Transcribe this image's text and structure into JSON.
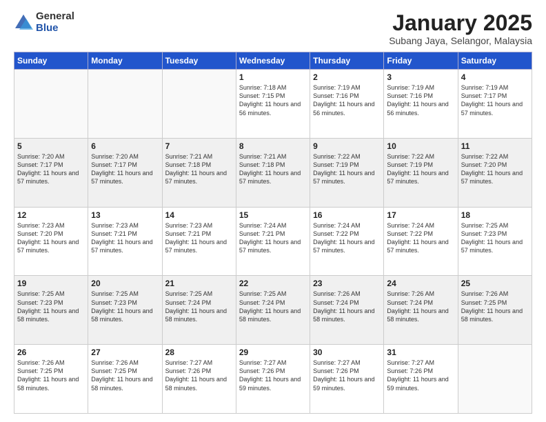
{
  "logo": {
    "general": "General",
    "blue": "Blue"
  },
  "header": {
    "month": "January 2025",
    "location": "Subang Jaya, Selangor, Malaysia"
  },
  "days_of_week": [
    "Sunday",
    "Monday",
    "Tuesday",
    "Wednesday",
    "Thursday",
    "Friday",
    "Saturday"
  ],
  "weeks": [
    [
      {
        "day": "",
        "info": ""
      },
      {
        "day": "",
        "info": ""
      },
      {
        "day": "",
        "info": ""
      },
      {
        "day": "1",
        "info": "Sunrise: 7:18 AM\nSunset: 7:15 PM\nDaylight: 11 hours and 56 minutes."
      },
      {
        "day": "2",
        "info": "Sunrise: 7:19 AM\nSunset: 7:16 PM\nDaylight: 11 hours and 56 minutes."
      },
      {
        "day": "3",
        "info": "Sunrise: 7:19 AM\nSunset: 7:16 PM\nDaylight: 11 hours and 56 minutes."
      },
      {
        "day": "4",
        "info": "Sunrise: 7:19 AM\nSunset: 7:17 PM\nDaylight: 11 hours and 57 minutes."
      }
    ],
    [
      {
        "day": "5",
        "info": "Sunrise: 7:20 AM\nSunset: 7:17 PM\nDaylight: 11 hours and 57 minutes."
      },
      {
        "day": "6",
        "info": "Sunrise: 7:20 AM\nSunset: 7:17 PM\nDaylight: 11 hours and 57 minutes."
      },
      {
        "day": "7",
        "info": "Sunrise: 7:21 AM\nSunset: 7:18 PM\nDaylight: 11 hours and 57 minutes."
      },
      {
        "day": "8",
        "info": "Sunrise: 7:21 AM\nSunset: 7:18 PM\nDaylight: 11 hours and 57 minutes."
      },
      {
        "day": "9",
        "info": "Sunrise: 7:22 AM\nSunset: 7:19 PM\nDaylight: 11 hours and 57 minutes."
      },
      {
        "day": "10",
        "info": "Sunrise: 7:22 AM\nSunset: 7:19 PM\nDaylight: 11 hours and 57 minutes."
      },
      {
        "day": "11",
        "info": "Sunrise: 7:22 AM\nSunset: 7:20 PM\nDaylight: 11 hours and 57 minutes."
      }
    ],
    [
      {
        "day": "12",
        "info": "Sunrise: 7:23 AM\nSunset: 7:20 PM\nDaylight: 11 hours and 57 minutes."
      },
      {
        "day": "13",
        "info": "Sunrise: 7:23 AM\nSunset: 7:21 PM\nDaylight: 11 hours and 57 minutes."
      },
      {
        "day": "14",
        "info": "Sunrise: 7:23 AM\nSunset: 7:21 PM\nDaylight: 11 hours and 57 minutes."
      },
      {
        "day": "15",
        "info": "Sunrise: 7:24 AM\nSunset: 7:21 PM\nDaylight: 11 hours and 57 minutes."
      },
      {
        "day": "16",
        "info": "Sunrise: 7:24 AM\nSunset: 7:22 PM\nDaylight: 11 hours and 57 minutes."
      },
      {
        "day": "17",
        "info": "Sunrise: 7:24 AM\nSunset: 7:22 PM\nDaylight: 11 hours and 57 minutes."
      },
      {
        "day": "18",
        "info": "Sunrise: 7:25 AM\nSunset: 7:23 PM\nDaylight: 11 hours and 57 minutes."
      }
    ],
    [
      {
        "day": "19",
        "info": "Sunrise: 7:25 AM\nSunset: 7:23 PM\nDaylight: 11 hours and 58 minutes."
      },
      {
        "day": "20",
        "info": "Sunrise: 7:25 AM\nSunset: 7:23 PM\nDaylight: 11 hours and 58 minutes."
      },
      {
        "day": "21",
        "info": "Sunrise: 7:25 AM\nSunset: 7:24 PM\nDaylight: 11 hours and 58 minutes."
      },
      {
        "day": "22",
        "info": "Sunrise: 7:25 AM\nSunset: 7:24 PM\nDaylight: 11 hours and 58 minutes."
      },
      {
        "day": "23",
        "info": "Sunrise: 7:26 AM\nSunset: 7:24 PM\nDaylight: 11 hours and 58 minutes."
      },
      {
        "day": "24",
        "info": "Sunrise: 7:26 AM\nSunset: 7:24 PM\nDaylight: 11 hours and 58 minutes."
      },
      {
        "day": "25",
        "info": "Sunrise: 7:26 AM\nSunset: 7:25 PM\nDaylight: 11 hours and 58 minutes."
      }
    ],
    [
      {
        "day": "26",
        "info": "Sunrise: 7:26 AM\nSunset: 7:25 PM\nDaylight: 11 hours and 58 minutes."
      },
      {
        "day": "27",
        "info": "Sunrise: 7:26 AM\nSunset: 7:25 PM\nDaylight: 11 hours and 58 minutes."
      },
      {
        "day": "28",
        "info": "Sunrise: 7:27 AM\nSunset: 7:26 PM\nDaylight: 11 hours and 58 minutes."
      },
      {
        "day": "29",
        "info": "Sunrise: 7:27 AM\nSunset: 7:26 PM\nDaylight: 11 hours and 59 minutes."
      },
      {
        "day": "30",
        "info": "Sunrise: 7:27 AM\nSunset: 7:26 PM\nDaylight: 11 hours and 59 minutes."
      },
      {
        "day": "31",
        "info": "Sunrise: 7:27 AM\nSunset: 7:26 PM\nDaylight: 11 hours and 59 minutes."
      },
      {
        "day": "",
        "info": ""
      }
    ]
  ]
}
